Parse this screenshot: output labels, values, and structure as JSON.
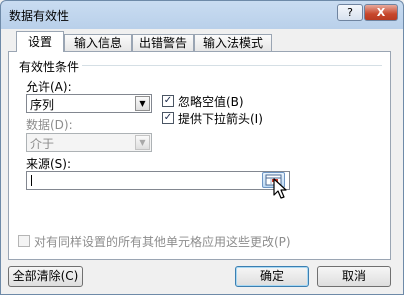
{
  "window": {
    "title": "数据有效性",
    "help_label": "?",
    "close_label": "X"
  },
  "tabs": [
    {
      "label": "设置",
      "active": true
    },
    {
      "label": "输入信息",
      "active": false
    },
    {
      "label": "出错警告",
      "active": false
    },
    {
      "label": "输入法模式",
      "active": false
    }
  ],
  "settings": {
    "group_title": "有效性条件",
    "allow_label": "允许(A):",
    "allow_value": "序列",
    "data_label": "数据(D):",
    "data_value": "介于",
    "ignore_blank_label": "忽略空值(B)",
    "ignore_blank_checked": true,
    "dropdown_label": "提供下拉箭头(I)",
    "dropdown_checked": true,
    "source_label": "来源(S):",
    "source_value": "",
    "apply_all_label": "对有同样设置的所有其他单元格应用这些更改(P)",
    "apply_all_checked": false
  },
  "footer": {
    "clear_all_label": "全部清除(C)",
    "ok_label": "确定",
    "cancel_label": "取消"
  },
  "icons": {
    "collapse_dialog": "range-select-icon",
    "cursor": "mouse-pointer-icon"
  }
}
